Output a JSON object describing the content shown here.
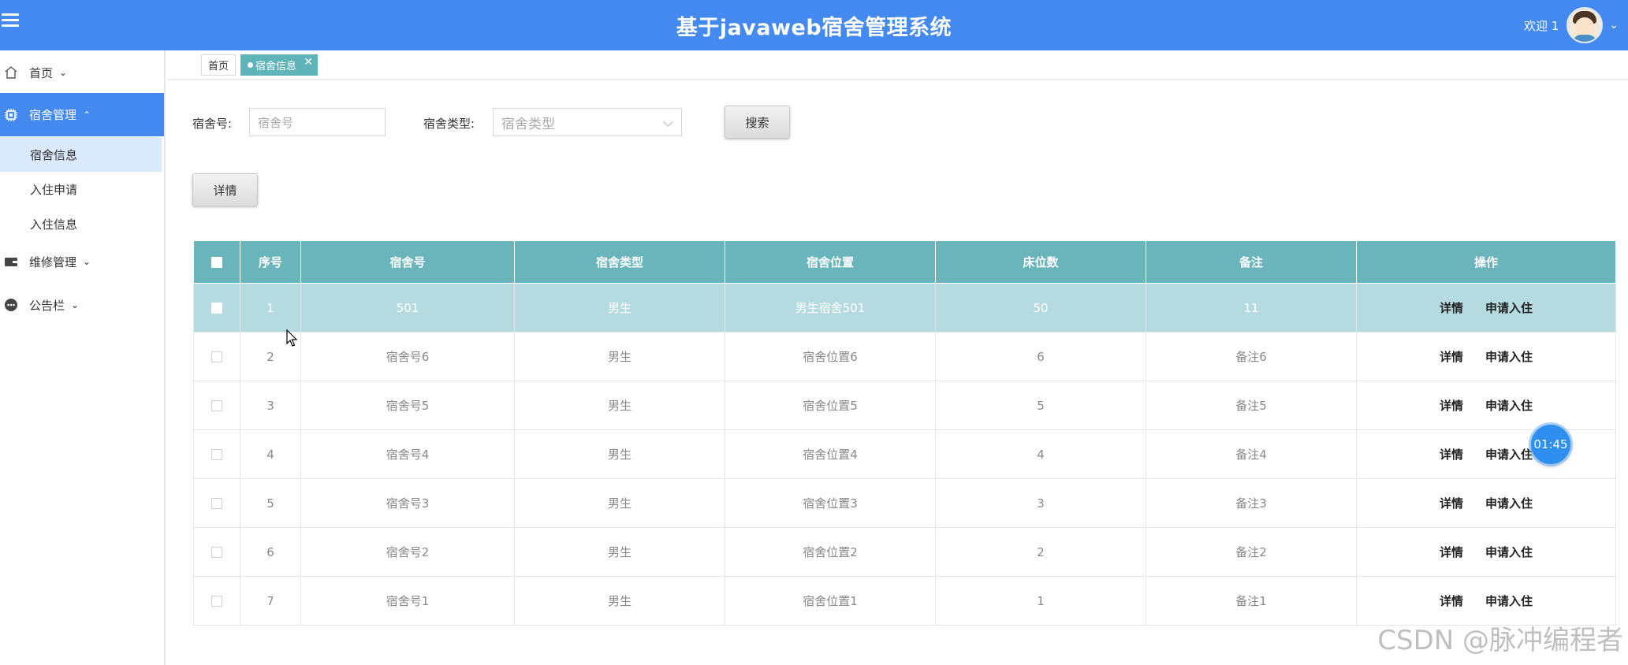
{
  "header": {
    "title": "基于javaweb宿舍管理系统",
    "welcome": "欢迎 1"
  },
  "sidebar": {
    "items": [
      {
        "label": "首页",
        "icon": "home-icon"
      },
      {
        "label": "宿舍管理",
        "icon": "chip-icon",
        "active": true,
        "children": [
          {
            "label": "宿舍信息",
            "active": true
          },
          {
            "label": "入住申请"
          },
          {
            "label": "入住信息"
          }
        ]
      },
      {
        "label": "维修管理",
        "icon": "wallet-icon"
      },
      {
        "label": "公告栏",
        "icon": "chat-icon"
      }
    ]
  },
  "tabs": {
    "home": "首页",
    "active": "宿舍信息"
  },
  "search": {
    "dorm_no_label": "宿舍号:",
    "dorm_no_placeholder": "宿舍号",
    "dorm_type_label": "宿舍类型:",
    "dorm_type_placeholder": "宿舍类型",
    "search_button": "搜索"
  },
  "toolbar": {
    "detail_button": "详情"
  },
  "table": {
    "headers": [
      "",
      "序号",
      "宿舍号",
      "宿舍类型",
      "宿舍位置",
      "床位数",
      "备注",
      "操作"
    ],
    "rows": [
      {
        "index": "1",
        "dorm_no": "501",
        "type": "男生",
        "location": "男生宿舍501",
        "beds": "50",
        "remark": "11"
      },
      {
        "index": "2",
        "dorm_no": "宿舍号6",
        "type": "男生",
        "location": "宿舍位置6",
        "beds": "6",
        "remark": "备注6"
      },
      {
        "index": "3",
        "dorm_no": "宿舍号5",
        "type": "男生",
        "location": "宿舍位置5",
        "beds": "5",
        "remark": "备注5"
      },
      {
        "index": "4",
        "dorm_no": "宿舍号4",
        "type": "男生",
        "location": "宿舍位置4",
        "beds": "4",
        "remark": "备注4"
      },
      {
        "index": "5",
        "dorm_no": "宿舍号3",
        "type": "男生",
        "location": "宿舍位置3",
        "beds": "3",
        "remark": "备注3"
      },
      {
        "index": "6",
        "dorm_no": "宿舍号2",
        "type": "男生",
        "location": "宿舍位置2",
        "beds": "2",
        "remark": "备注2"
      },
      {
        "index": "7",
        "dorm_no": "宿舍号1",
        "type": "男生",
        "location": "宿舍位置1",
        "beds": "1",
        "remark": "备注1"
      }
    ],
    "ops": {
      "detail": "详情",
      "apply": "申请入住"
    }
  },
  "timer": "01:45",
  "watermark": "CSDN @脉冲编程者",
  "colors": {
    "header": "#4389ef",
    "table_header": "#6ab4bc",
    "row_highlight": "#b5dbe0",
    "tab_active": "#5fb4b9"
  }
}
